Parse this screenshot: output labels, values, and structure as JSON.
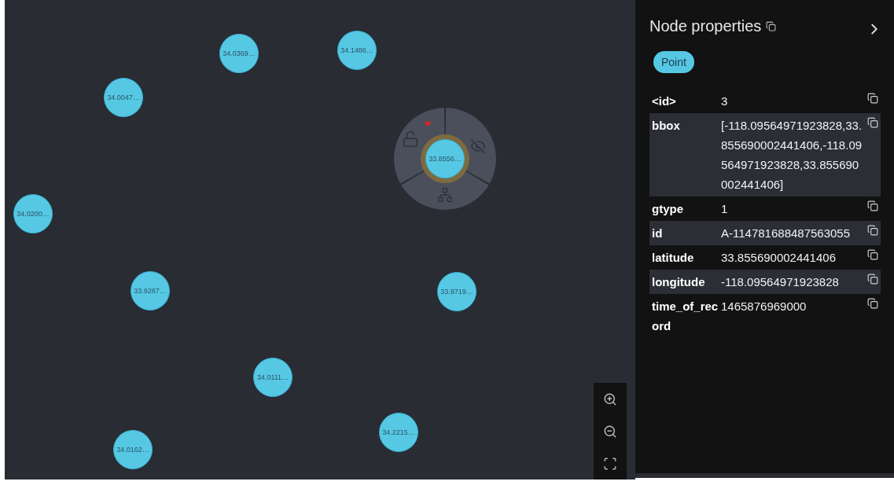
{
  "graph": {
    "nodes": [
      {
        "label": "34.0369…",
        "selected": false
      },
      {
        "label": "34.1486…",
        "selected": false
      },
      {
        "label": "34.0047…",
        "selected": false
      },
      {
        "label": "33.8556…",
        "selected": true
      },
      {
        "label": "34.0200…",
        "selected": false
      },
      {
        "label": "33.9287…",
        "selected": false
      },
      {
        "label": "33.9719…",
        "selected": false
      },
      {
        "label": "34.0111…",
        "selected": false
      },
      {
        "label": "34.2215…",
        "selected": false
      },
      {
        "label": "34.0162…",
        "selected": false
      }
    ]
  },
  "panel": {
    "title": "Node properties",
    "badge": "Point",
    "properties": [
      {
        "key": "<id>",
        "value": "3"
      },
      {
        "key": "bbox",
        "value": "[-118.09564971923828,33.855690002441406,-118.09564971923828,33.855690002441406]"
      },
      {
        "key": "gtype",
        "value": "1"
      },
      {
        "key": "id",
        "value": "A-114781688487563055"
      },
      {
        "key": "latitude",
        "value": "33.855690002441406"
      },
      {
        "key": "longitude",
        "value": "-118.09564971923828"
      },
      {
        "key": "time_of_record",
        "value": "1465876969000"
      }
    ]
  }
}
